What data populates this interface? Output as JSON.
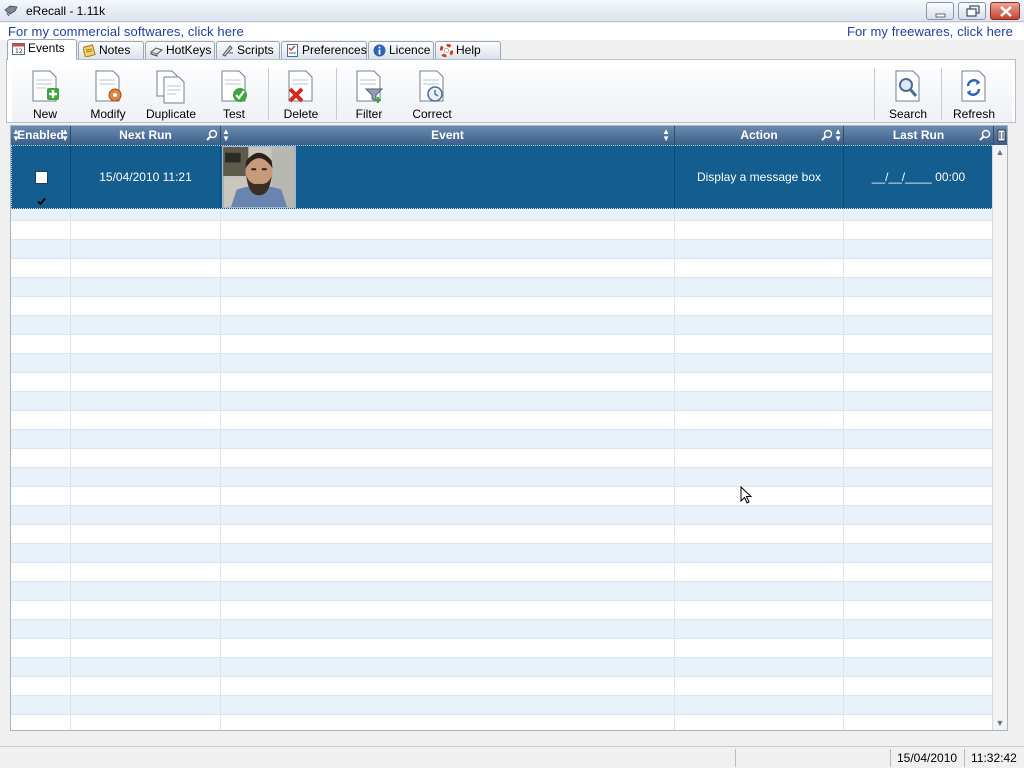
{
  "window": {
    "title": "eRecall - 1.11k",
    "controls": [
      "minimize",
      "restore",
      "close"
    ]
  },
  "links": {
    "commercial": "For my commercial softwares, click here",
    "freeware": "For my freewares, click here"
  },
  "tabs": [
    {
      "label": "Events",
      "icon": "calendar-icon",
      "active": true
    },
    {
      "label": "Notes",
      "icon": "note-icon",
      "active": false
    },
    {
      "label": "HotKeys",
      "icon": "keyboard-icon",
      "active": false
    },
    {
      "label": "Scripts",
      "icon": "script-icon",
      "active": false
    },
    {
      "label": "Preferences",
      "icon": "checklist-icon",
      "active": false
    },
    {
      "label": "Licence",
      "icon": "info-icon",
      "active": false
    },
    {
      "label": "Help",
      "icon": "lifebuoy-icon",
      "active": false
    }
  ],
  "toolbar": {
    "new": "New",
    "modify": "Modify",
    "duplicate": "Duplicate",
    "test": "Test",
    "delete": "Delete",
    "filter": "Filter",
    "correct": "Correct",
    "search": "Search",
    "refresh": "Refresh"
  },
  "grid": {
    "columns": [
      "Enabled",
      "Next Run",
      "Event",
      "Action",
      "Last Run"
    ],
    "rows": [
      {
        "enabled": true,
        "next_run": "15/04/2010 11:21",
        "event": "photo-thumbnail",
        "action": "Display a message box",
        "last_run": "__/__/____ 00:00",
        "selected": true
      }
    ]
  },
  "status": {
    "date": "15/04/2010",
    "time": "11:32:42"
  },
  "colors": {
    "selection": "#135d8f",
    "header": "#4a6d96",
    "link": "#1f3f9c",
    "alt_row": "#e9f1fb"
  }
}
